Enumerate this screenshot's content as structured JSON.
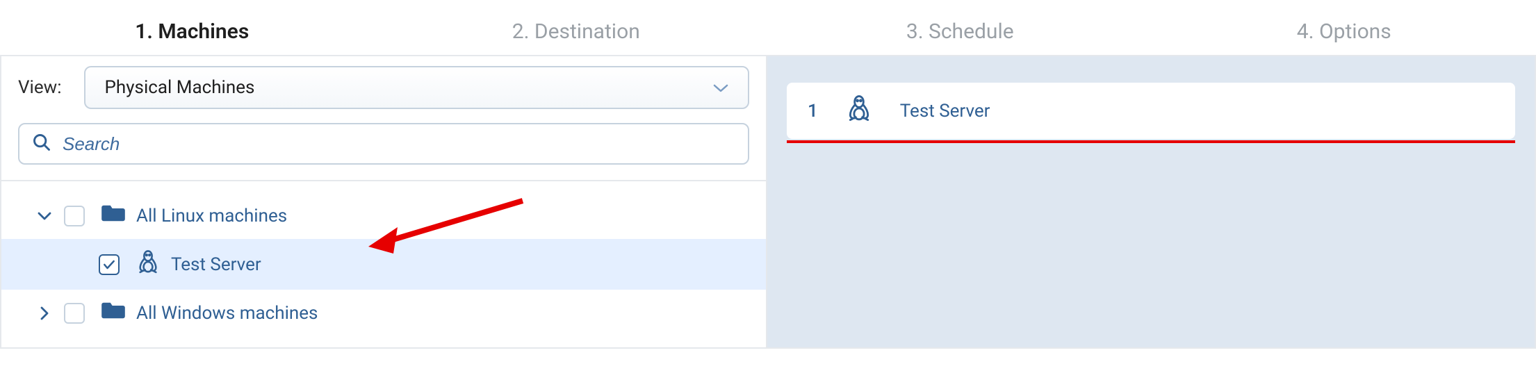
{
  "steps": [
    {
      "label": "1. Machines",
      "active": true
    },
    {
      "label": "2. Destination",
      "active": false
    },
    {
      "label": "3. Schedule",
      "active": false
    },
    {
      "label": "4. Options",
      "active": false
    }
  ],
  "view": {
    "label": "View:",
    "selected": "Physical Machines"
  },
  "search": {
    "placeholder": "Search"
  },
  "tree": [
    {
      "type": "folder",
      "label": "All Linux machines",
      "expanded": true,
      "checked": false,
      "children": [
        {
          "type": "machine",
          "label": "Test Server",
          "checked": true
        }
      ]
    },
    {
      "type": "folder",
      "label": "All Windows machines",
      "expanded": false,
      "checked": false,
      "children": []
    }
  ],
  "selected_machines": [
    {
      "index": "1",
      "label": "Test Server"
    }
  ]
}
